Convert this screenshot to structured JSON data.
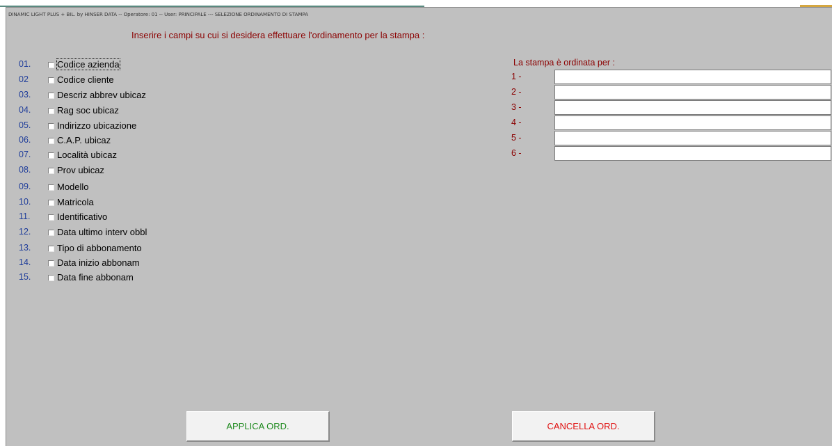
{
  "window": {
    "title": "DINAMIC LIGHT PLUS + BIL. by HINSER DATA --  Operatore: 01 -- User: PRINCIPALE --- SELEZIONE ORDINAMENTO DI STAMPA"
  },
  "instructions": "Inserire i campi su cui si desidera effettuare l'ordinamento per la stampa :",
  "fields": [
    {
      "num": "01.",
      "label": "Codice azienda"
    },
    {
      "num": "02",
      "label": "Codice cliente"
    },
    {
      "num": "03.",
      "label": "Descriz abbrev ubicaz"
    },
    {
      "num": "04.",
      "label": "Rag soc ubicaz"
    },
    {
      "num": "05.",
      "label": "Indirizzo ubicazione"
    },
    {
      "num": "06.",
      "label": "C.A.P. ubicaz"
    },
    {
      "num": "07.",
      "label": "Località ubicaz"
    },
    {
      "num": "08.",
      "label": "Prov ubicaz"
    },
    {
      "num": "09.",
      "label": "Modello"
    },
    {
      "num": "10.",
      "label": "Matricola"
    },
    {
      "num": "11.",
      "label": "Identificativo"
    },
    {
      "num": "12.",
      "label": "Data ultimo interv obbl"
    },
    {
      "num": "13.",
      "label": "Tipo di abbonamento"
    },
    {
      "num": "14.",
      "label": "Data inizio abbonam"
    },
    {
      "num": "15.",
      "label": "Data fine abbonam"
    }
  ],
  "order": {
    "title": "La stampa è ordinata per :",
    "rows": [
      {
        "label": "1 -",
        "value": ""
      },
      {
        "label": "2 -",
        "value": ""
      },
      {
        "label": "3 -",
        "value": ""
      },
      {
        "label": "4 -",
        "value": ""
      },
      {
        "label": "5 -",
        "value": ""
      },
      {
        "label": "6 -",
        "value": ""
      }
    ]
  },
  "buttons": {
    "apply": "APPLICA ORD.",
    "cancel": "CANCELLA ORD."
  },
  "colors": {
    "background": "#c0c0c0",
    "label_red": "#8b0000",
    "number_blue": "#1f3d9a",
    "apply_green": "#1f8a1f",
    "cancel_red": "#e01010"
  }
}
